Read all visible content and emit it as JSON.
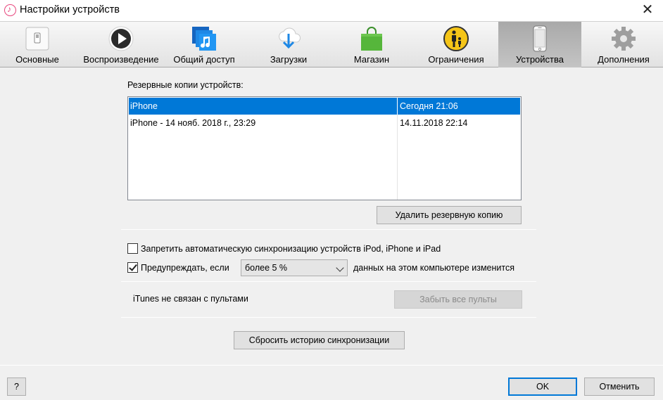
{
  "window": {
    "title": "Настройки устройств",
    "close_glyph": "✕"
  },
  "toolbar": {
    "tabs": [
      {
        "label": "Основные",
        "icon": "switch-icon"
      },
      {
        "label": "Воспроизведение",
        "icon": "play-icon"
      },
      {
        "label": "Общий доступ",
        "icon": "shared-music-icon"
      },
      {
        "label": "Загрузки",
        "icon": "cloud-download-icon"
      },
      {
        "label": "Магазин",
        "icon": "shopping-bag-icon"
      },
      {
        "label": "Ограничения",
        "icon": "parental-controls-icon"
      },
      {
        "label": "Устройства",
        "icon": "iphone-icon",
        "active": true
      },
      {
        "label": "Дополнения",
        "icon": "gear-icon"
      }
    ]
  },
  "backups": {
    "heading": "Резервные копии устройств:",
    "rows": [
      {
        "name": "iPhone",
        "date": "Сегодня 21:06",
        "selected": true
      },
      {
        "name": "iPhone - 14 нояб. 2018 г., 23:29",
        "date": "14.11.2018 22:14",
        "selected": false
      }
    ],
    "delete_button": "Удалить резервную копию"
  },
  "sync": {
    "prevent_auto_sync": {
      "label": "Запретить автоматическую синхронизацию устройств iPod, iPhone и iPad",
      "checked": false
    },
    "warn": {
      "label": "Предупреждать, если",
      "checked": true,
      "selected_option": "более 5 %",
      "suffix": "данных на этом компьютере изменится"
    }
  },
  "remotes": {
    "status": "iTunes не связан с пультами",
    "forget_button": "Забыть все пульты"
  },
  "reset_button": "Сбросить историю синхронизации",
  "footer": {
    "help": "?",
    "ok": "OK",
    "cancel": "Отменить"
  },
  "colors": {
    "selection": "#0078d7",
    "default_button_border": "#0078d7"
  }
}
